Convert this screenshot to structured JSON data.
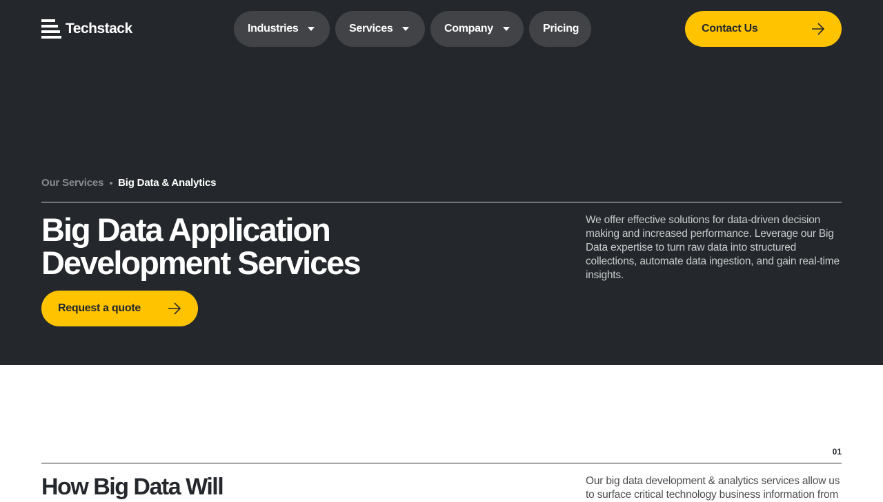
{
  "header": {
    "logo_text": "Techstack",
    "nav": [
      {
        "label": "Industries",
        "has_dropdown": true
      },
      {
        "label": "Services",
        "has_dropdown": true
      },
      {
        "label": "Company",
        "has_dropdown": true
      },
      {
        "label": "Pricing",
        "has_dropdown": false
      }
    ],
    "contact_label": "Contact Us"
  },
  "breadcrumb": {
    "parent": "Our Services",
    "current": "Big Data & Analytics"
  },
  "hero": {
    "title_line1": "Big Data Application",
    "title_line2": "Development Services",
    "description": "We offer effective solutions for data-driven decision making and increased performance. Leverage our Big Data expertise to turn raw data into structured collections, automate data ingestion, and gain real-time insights.",
    "cta_label": "Request a quote"
  },
  "section": {
    "number": "01",
    "title": "How Big Data Will",
    "description": "Our big data development & analytics services allow us to surface critical technology business information from"
  },
  "colors": {
    "hero_bg": "#24282c",
    "accent": "#ffc300",
    "nav_pill": "#414346"
  },
  "icons": [
    "arrow-right-icon",
    "caret-down-icon"
  ]
}
